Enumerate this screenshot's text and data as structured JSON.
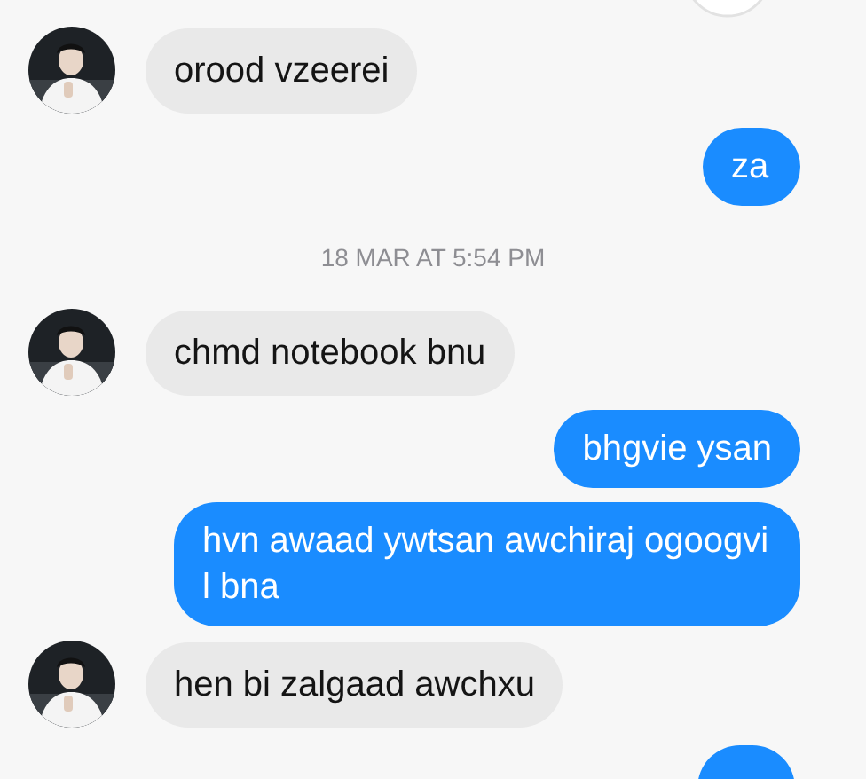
{
  "messages": [
    {
      "kind": "received",
      "text": "orood vzeerei"
    },
    {
      "kind": "sent",
      "text": "za"
    },
    {
      "kind": "timestamp",
      "text": "18 MAR AT 5:54 PM"
    },
    {
      "kind": "received",
      "text": "chmd notebook bnu"
    },
    {
      "kind": "sent",
      "text": "bhgvie ysan"
    },
    {
      "kind": "sent",
      "text": "hvn awaad ywtsan awchiraj ogoogvi l bna"
    },
    {
      "kind": "received",
      "text": "hen bi zalgaad awchxu"
    },
    {
      "kind": "sent_partial"
    }
  ]
}
